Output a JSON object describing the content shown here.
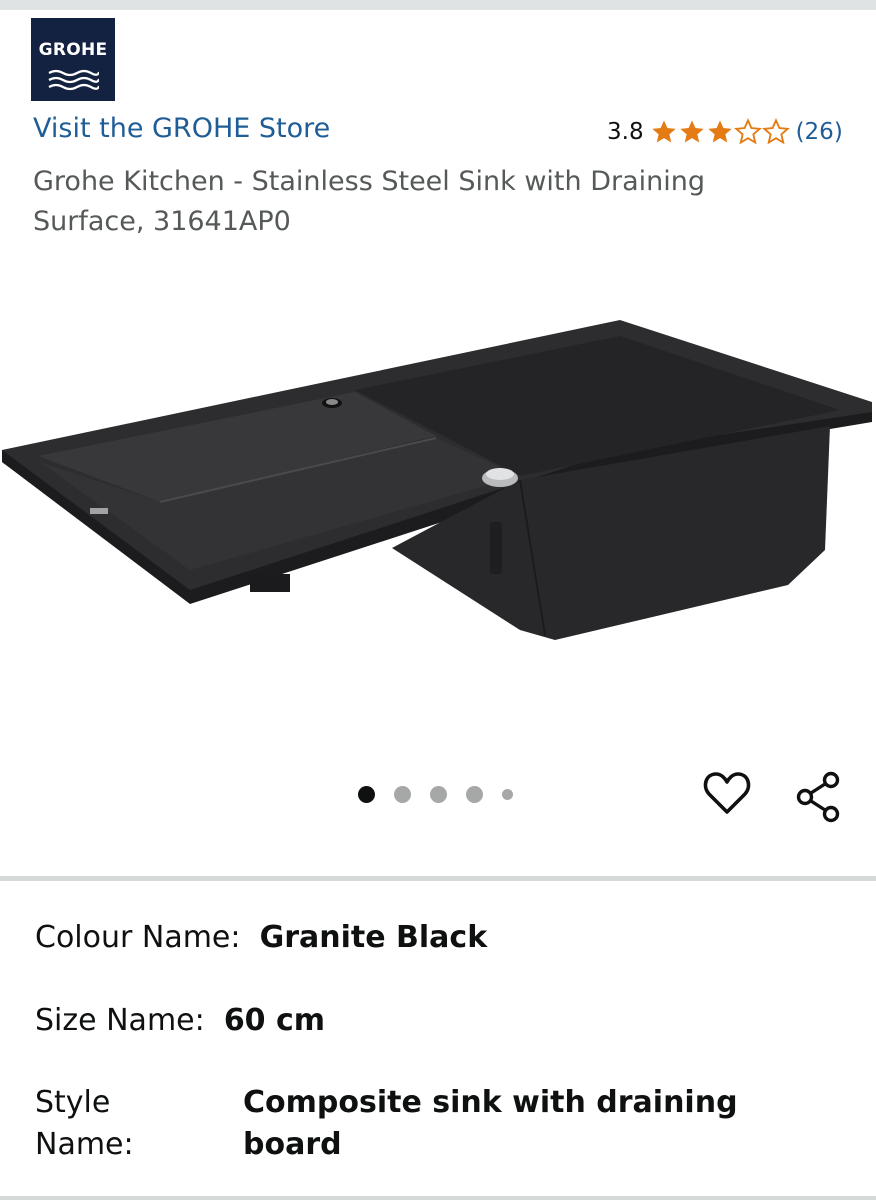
{
  "brand": {
    "logo_text": "GROHE",
    "store_link": "Visit the GROHE Store"
  },
  "rating": {
    "score": "3.8",
    "stars": 3.8,
    "max_stars": 5,
    "count": "(26)",
    "star_color": "#e57b14"
  },
  "product": {
    "title": "Grohe Kitchen - Stainless Steel Sink with Draining Surface, 31641AP0",
    "image_icon": "sink-product-image"
  },
  "carousel": {
    "total": 5,
    "active_index": 0
  },
  "actions": {
    "wishlist_icon": "heart-icon",
    "share_icon": "share-icon"
  },
  "variations": {
    "colour": {
      "label": "Colour Name:",
      "value": "Granite Black"
    },
    "size": {
      "label": "Size Name:",
      "value": "60 cm"
    },
    "style": {
      "label_line1": "Style",
      "label_line2": "Name:",
      "value_line1": "Composite sink with draining",
      "value_line2": "board"
    }
  },
  "colors": {
    "link": "#1f5d96",
    "logo_bg": "#132240"
  }
}
